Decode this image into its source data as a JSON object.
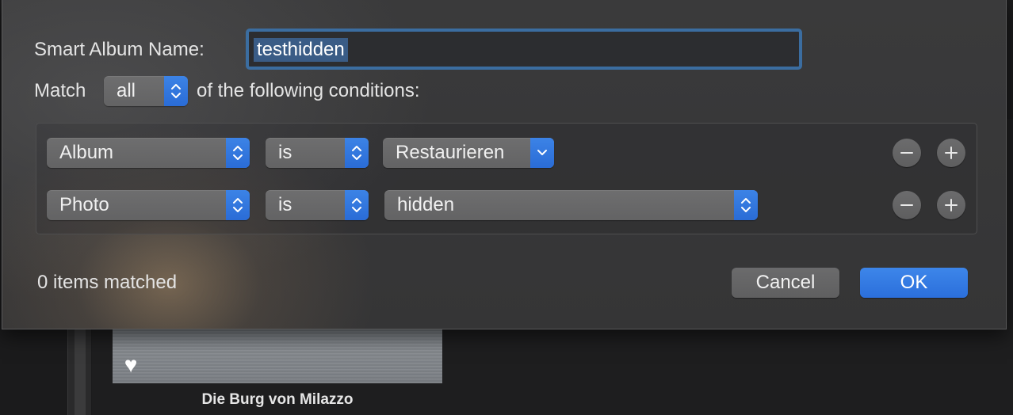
{
  "dialog": {
    "name_label": "Smart Album Name:",
    "name_value": "testhidden",
    "match_label": "Match",
    "match_value": "all",
    "match_suffix": "of the following conditions:",
    "conditions": [
      {
        "field": "Album",
        "operator": "is",
        "value": "Restaurieren"
      },
      {
        "field": "Photo",
        "operator": "is",
        "value": "hidden"
      }
    ],
    "status_text": "0 items matched",
    "cancel_label": "Cancel",
    "ok_label": "OK"
  },
  "background": {
    "photo_caption": "Die Burg von Milazzo",
    "favorite_icon": "heart-icon"
  },
  "icons": {
    "stepper": "up-down-chevron-icon",
    "dropdown": "chevron-down-icon",
    "remove": "minus-icon",
    "add": "plus-icon"
  },
  "colors": {
    "accent": "#2f74de",
    "focus_ring": "#3b6da0",
    "selection": "#3a5c86"
  }
}
